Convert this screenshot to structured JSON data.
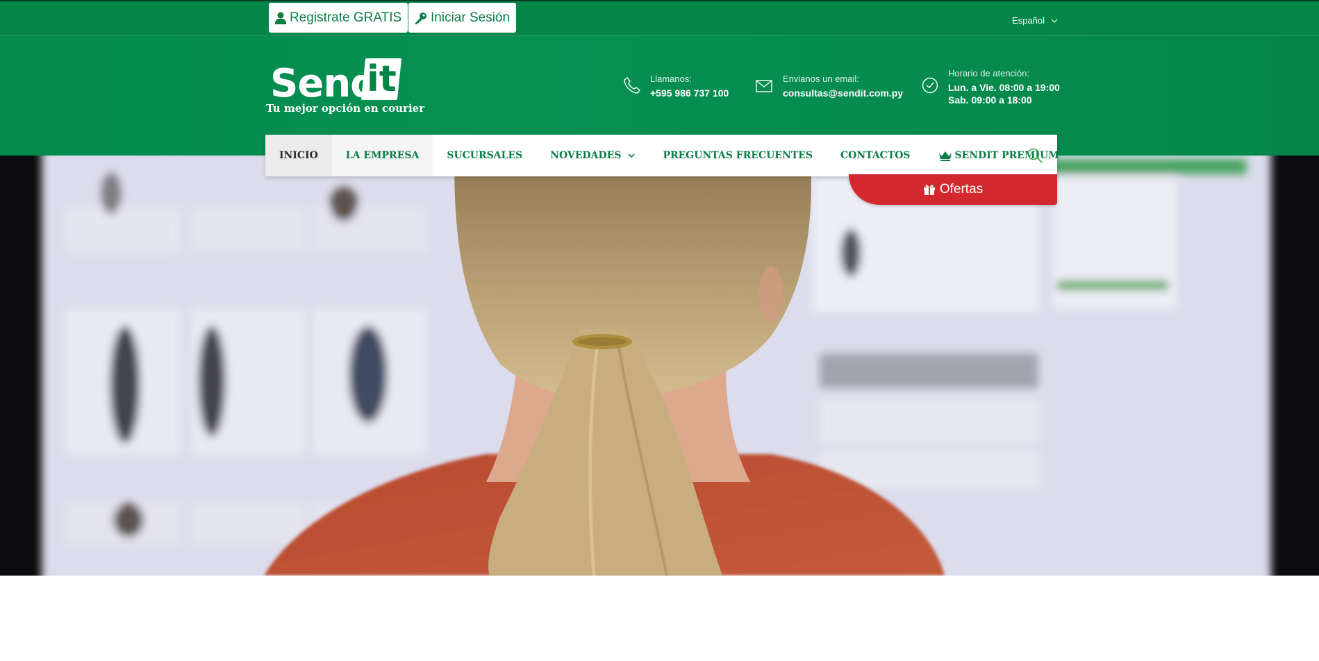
{
  "topbar": {
    "register_label": "Registrate GRATIS",
    "login_label": "Iniciar Sesión",
    "language": "Español"
  },
  "brand": {
    "logo_main": "Send",
    "logo_accent": "it",
    "tagline": "Tu mejor opción en courier"
  },
  "contact": {
    "phone_label": "Llamanos:",
    "phone": "+595 986 737 100",
    "email_label": "Envianos un email:",
    "email": "consultas@sendit.com.py",
    "hours_label": "Horario de atención:",
    "hours_weekdays": "Lun. a Vie. 08:00 a 19:00",
    "hours_saturday": "Sab. 09:00 a 18:00"
  },
  "nav": {
    "items": [
      {
        "label": "INICIO"
      },
      {
        "label": "LA EMPRESA"
      },
      {
        "label": "SUCURSALES"
      },
      {
        "label": "NOVEDADES"
      },
      {
        "label": "PREGUNTAS FRECUENTES"
      },
      {
        "label": "CONTACTOS"
      },
      {
        "label": "SENDIT PREMIUM"
      }
    ]
  },
  "offers": {
    "label": "Ofertas"
  },
  "colors": {
    "brand_green": "#048649",
    "offers_red": "#d3292e"
  }
}
